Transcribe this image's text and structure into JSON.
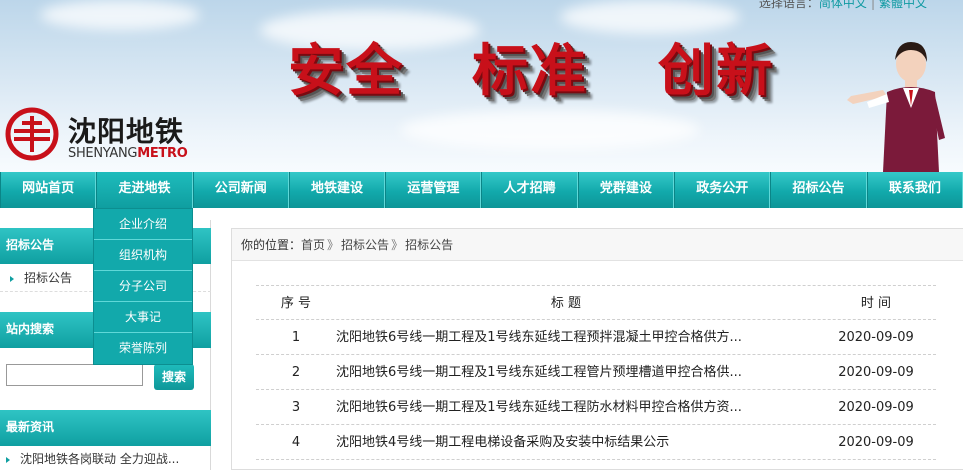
{
  "header": {
    "lang_label": "选择语言：",
    "lang_simplified": "简体中文",
    "lang_separator": "|",
    "lang_traditional": "繁體中文",
    "slogan": [
      "安全",
      "标准",
      "创新"
    ],
    "logo_cn": "沈阳地铁",
    "logo_en_prefix": "SHENYANG",
    "logo_en_suffix": "METRO"
  },
  "nav": {
    "items": [
      "网站首页",
      "走进地铁",
      "公司新闻",
      "地铁建设",
      "运营管理",
      "人才招聘",
      "党群建设",
      "政务公开",
      "招标公告",
      "联系我们"
    ],
    "active_index": 1
  },
  "dropdown": {
    "items": [
      "企业介绍",
      "组织机构",
      "分子公司",
      "大事记",
      "荣誉陈列"
    ]
  },
  "sidebar": {
    "section1_title": "招标公告",
    "section1_link": "招标公告",
    "search_title": "站内搜索",
    "search_value": "",
    "search_button": "搜索",
    "news_title": "最新资讯",
    "news_item": "沈阳地铁各岗联动 全力迎战..."
  },
  "breadcrumb": {
    "label": "你的位置：",
    "home": "首页",
    "arrow": "》",
    "level1": "招标公告",
    "level2": "招标公告"
  },
  "table": {
    "headers": {
      "no": "序 号",
      "title": "标 题",
      "time": "时 间"
    },
    "rows": [
      {
        "no": "1",
        "title": "沈阳地铁6号线一期工程及1号线东延线工程预拌混凝土甲控合格供方...",
        "time": "2020-09-09"
      },
      {
        "no": "2",
        "title": "沈阳地铁6号线一期工程及1号线东延线工程管片预埋槽道甲控合格供...",
        "time": "2020-09-09"
      },
      {
        "no": "3",
        "title": "沈阳地铁6号线一期工程及1号线东延线工程防水材料甲控合格供方资...",
        "time": "2020-09-09"
      },
      {
        "no": "4",
        "title": "沈阳地铁4号线一期工程电梯设备采购及安装中标结果公示",
        "time": "2020-09-09"
      }
    ]
  },
  "colors": {
    "teal": "#12a9ab",
    "brand_red": "#c8101a"
  }
}
